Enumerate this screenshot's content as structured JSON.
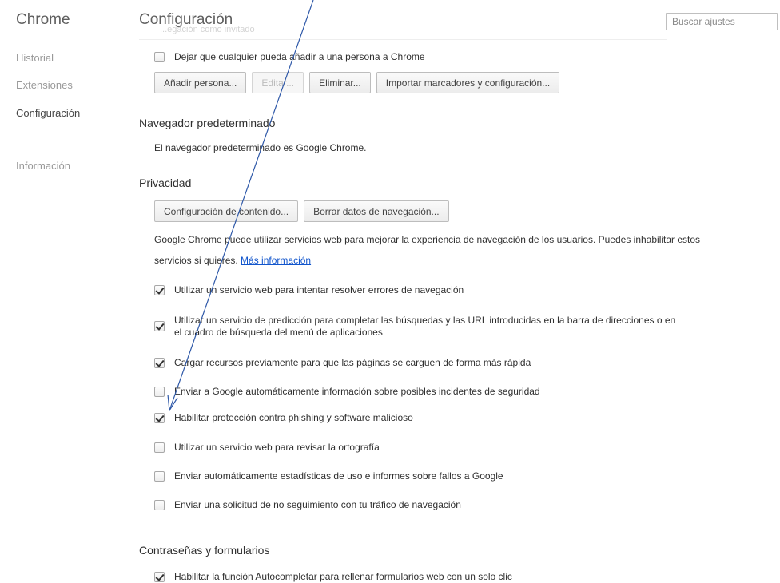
{
  "sidebar": {
    "brand": "Chrome",
    "items": [
      {
        "label": "Historial"
      },
      {
        "label": "Extensiones"
      },
      {
        "label": "Configuración"
      },
      {
        "label": "Información"
      }
    ]
  },
  "header": {
    "title": "Configuración",
    "search_placeholder": "Buscar ajustes",
    "ghost_text": "...egación como invitado"
  },
  "people": {
    "checkbox": {
      "label": "Dejar que cualquier pueda añadir a una persona a Chrome",
      "checked": false
    },
    "buttons": [
      "Añadir persona...",
      "Editar...",
      "Eliminar...",
      "Importar marcadores y configuración..."
    ]
  },
  "default_browser": {
    "title": "Navegador predeterminado",
    "text": "El navegador predeterminado es Google Chrome."
  },
  "privacy": {
    "title": "Privacidad",
    "buttons": [
      "Configuración de contenido...",
      "Borrar datos de navegación..."
    ],
    "description": "Google Chrome puede utilizar servicios web para mejorar la experiencia de navegación de los usuarios. Puedes inhabilitar estos servicios si quieres.",
    "more_link": "Más información",
    "options": [
      {
        "label": "Utilizar un servicio web para intentar resolver errores de navegación",
        "checked": true
      },
      {
        "label": "Utilizar un servicio de predicción para completar las búsquedas y las URL introducidas en la barra de direcciones o en el cuadro de búsqueda del menú de aplicaciones",
        "checked": true
      },
      {
        "label": "Cargar recursos previamente para que las páginas se carguen de forma más rápida",
        "checked": true
      },
      {
        "label": "Enviar a Google automáticamente información sobre posibles incidentes de seguridad",
        "checked": false
      },
      {
        "label": "Habilitar protección contra phishing y software malicioso",
        "checked": true
      },
      {
        "label": "Utilizar un servicio web para revisar la ortografía",
        "checked": false
      },
      {
        "label": "Enviar automáticamente estadísticas de uso e informes sobre fallos a Google",
        "checked": false
      },
      {
        "label": "Enviar una solicitud de no seguimiento con tu tráfico de navegación",
        "checked": false
      }
    ]
  },
  "passwords": {
    "title": "Contraseñas y formularios",
    "option": {
      "label": "Habilitar la función Autocompletar para rellenar formularios web con un solo clic",
      "checked": true
    }
  },
  "annotation": {
    "color": "#2e58a8"
  }
}
